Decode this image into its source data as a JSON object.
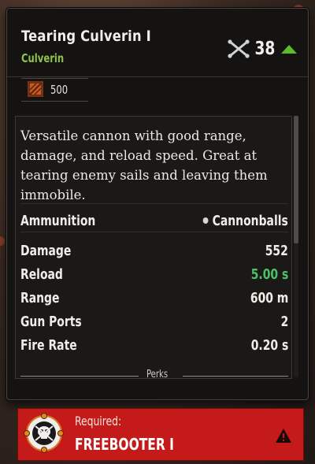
{
  "item": {
    "name": "Tearing Culverin I",
    "type": "Culverin",
    "level": "38",
    "level_icon": "crossed-cannons-icon",
    "level_trend_icon": "up-arrow-icon",
    "cost_icon": "crate-icon",
    "cost": "500",
    "description": "Versatile cannon with good range, damage, and reload speed. Great at tearing enemy sails and leaving them immobile."
  },
  "stats": [
    {
      "label": "Ammunition",
      "value": "Cannonballs",
      "icon": "cannonball-icon"
    },
    {
      "label": "Damage",
      "value": "552"
    },
    {
      "label": "Reload",
      "value": "5.00 s",
      "highlight": true
    },
    {
      "label": "Range",
      "value": "600 m"
    },
    {
      "label": "Gun Ports",
      "value": "2"
    },
    {
      "label": "Fire Rate",
      "value": "0.20 s"
    }
  ],
  "perks_label": "Perks",
  "requirement": {
    "label": "Required:",
    "value": "FREEBOOTER I",
    "badge_icon": "pirate-skull-badge-icon",
    "warning_icon": "warning-icon"
  },
  "colors": {
    "accent_green": "#8fc24a",
    "stat_green": "#4fc06a",
    "level_arrow_green": "#5dbb2d",
    "required_red": "#c41b1a",
    "cost_orange": "#c15a25"
  }
}
